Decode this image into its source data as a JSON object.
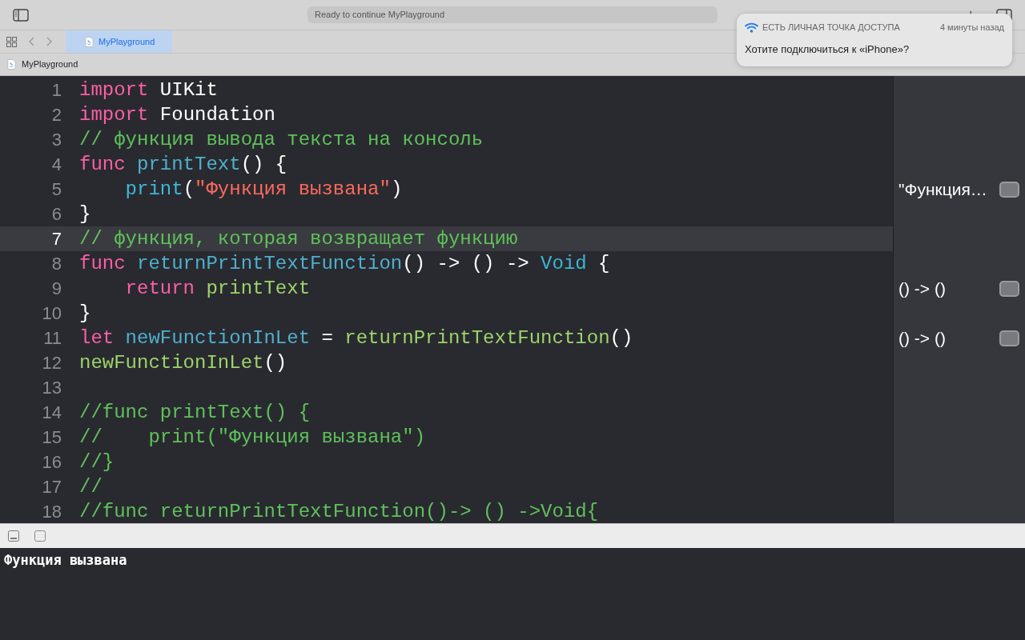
{
  "toolbar": {
    "status": "Ready to continue MyPlayground"
  },
  "tab": {
    "label": "MyPlayground",
    "selected": true
  },
  "jump_bar": {
    "label": "MyPlayground"
  },
  "notification": {
    "title": "ЕСТЬ ЛИЧНАЯ ТОЧКА ДОСТУПА",
    "time": "4 минуты назад",
    "message": "Хотите подключиться к «iPhone»?"
  },
  "lines": [
    {
      "n": "1",
      "selected": false,
      "tokens": [
        {
          "kind": "keyword",
          "text": "import"
        },
        {
          "kind": "plain",
          "text": " UIKit"
        }
      ]
    },
    {
      "n": "2",
      "selected": false,
      "tokens": [
        {
          "kind": "keyword",
          "text": "import"
        },
        {
          "kind": "plain",
          "text": " Foundation"
        }
      ]
    },
    {
      "n": "3",
      "selected": false,
      "tokens": [
        {
          "kind": "comment",
          "text": "// функция вывода текста на консоль"
        }
      ]
    },
    {
      "n": "4",
      "selected": false,
      "tokens": [
        {
          "kind": "keyword",
          "text": "func"
        },
        {
          "kind": "decl",
          "text": " printText"
        },
        {
          "kind": "plain",
          "text": "() {"
        }
      ]
    },
    {
      "n": "5",
      "selected": false,
      "result": "\"Функция…",
      "tokens": [
        {
          "kind": "call",
          "text": "    print"
        },
        {
          "kind": "plain",
          "text": "("
        },
        {
          "kind": "string",
          "text": "\"Функция вызвана\""
        },
        {
          "kind": "plain",
          "text": ")"
        }
      ]
    },
    {
      "n": "6",
      "selected": false,
      "tokens": [
        {
          "kind": "plain",
          "text": "}"
        }
      ]
    },
    {
      "n": "7",
      "selected": true,
      "tokens": [
        {
          "kind": "comment",
          "text": "// функция, которая возвращает функцию"
        }
      ]
    },
    {
      "n": "8",
      "selected": false,
      "tokens": [
        {
          "kind": "keyword",
          "text": "func"
        },
        {
          "kind": "decl",
          "text": " returnPrintTextFunction"
        },
        {
          "kind": "plain",
          "text": "() -> () -> "
        },
        {
          "kind": "type",
          "text": "Void"
        },
        {
          "kind": "plain",
          "text": " {"
        }
      ]
    },
    {
      "n": "9",
      "selected": false,
      "result": "() -> ()",
      "tokens": [
        {
          "kind": "keyword",
          "text": "    return"
        },
        {
          "kind": "ref",
          "text": " printText"
        }
      ]
    },
    {
      "n": "10",
      "selected": false,
      "tokens": [
        {
          "kind": "plain",
          "text": "}"
        }
      ]
    },
    {
      "n": "11",
      "selected": false,
      "result": "() -> ()",
      "tokens": [
        {
          "kind": "keyword",
          "text": "let"
        },
        {
          "kind": "decl",
          "text": " newFunctionInLet"
        },
        {
          "kind": "plain",
          "text": " = "
        },
        {
          "kind": "ref",
          "text": "returnPrintTextFunction"
        },
        {
          "kind": "plain",
          "text": "()"
        }
      ]
    },
    {
      "n": "12",
      "selected": false,
      "tokens": [
        {
          "kind": "ref",
          "text": "newFunctionInLet"
        },
        {
          "kind": "plain",
          "text": "()"
        }
      ]
    },
    {
      "n": "13",
      "selected": false
    },
    {
      "n": "14",
      "selected": false,
      "tokens": [
        {
          "kind": "comment",
          "text": "//func printText() {"
        }
      ]
    },
    {
      "n": "15",
      "selected": false,
      "tokens": [
        {
          "kind": "comment",
          "text": "//    print(\"Функция вызвана\")"
        }
      ]
    },
    {
      "n": "16",
      "selected": false,
      "tokens": [
        {
          "kind": "comment",
          "text": "//}"
        }
      ]
    },
    {
      "n": "17",
      "selected": false,
      "tokens": [
        {
          "kind": "comment",
          "text": "//"
        }
      ]
    },
    {
      "n": "18",
      "selected": false,
      "tokens": [
        {
          "kind": "comment",
          "text": "//func returnPrintTextFunction()-> () ->Void{"
        }
      ]
    }
  ],
  "console": {
    "output": "Функция вызвана"
  }
}
